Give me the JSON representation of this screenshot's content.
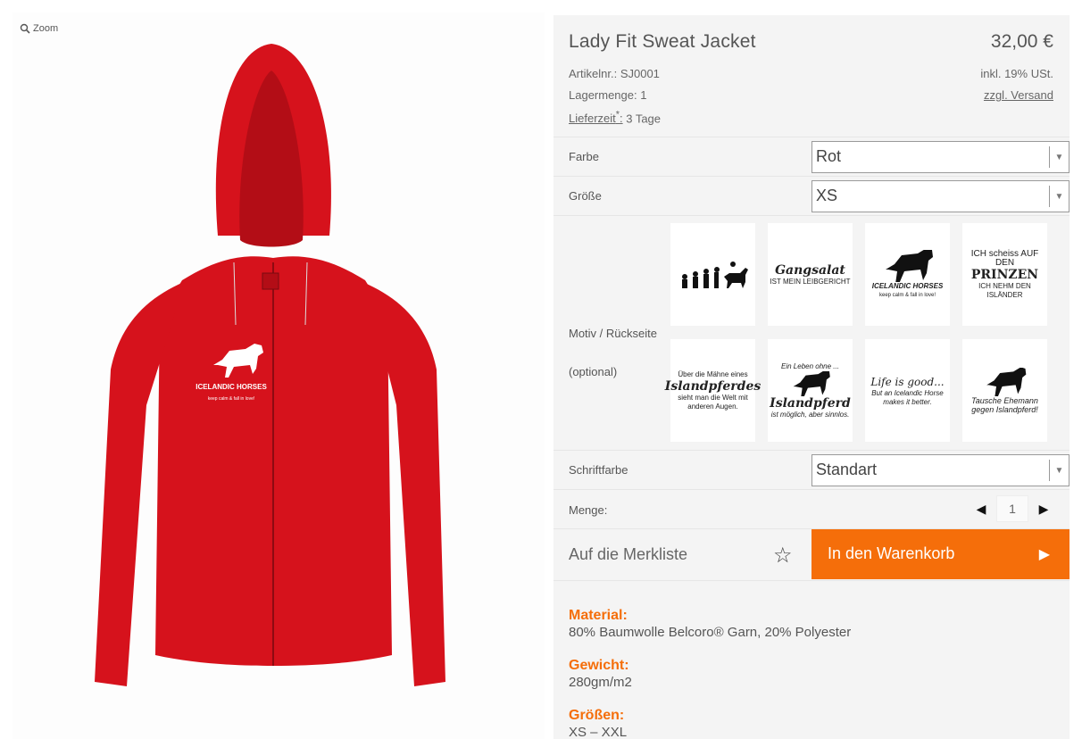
{
  "zoom_label": "Zoom",
  "product": {
    "title": "Lady Fit Sweat Jacket",
    "price": "32,00 €",
    "article_label": "Artikelnr.:",
    "article_no": "SJ0001",
    "stock_label": "Lagermenge:",
    "stock_value": "1",
    "delivery_label": "Lieferzeit",
    "delivery_sup": "*",
    "delivery_colon": ":",
    "delivery_value": "3 Tage",
    "tax_note": "inkl. 19% USt.",
    "shipping_link": "zzgl. Versand",
    "chest_print_title": "ICELANDIC HORSES",
    "chest_print_sub": "keep calm & fall in love!"
  },
  "options": {
    "farbe_label": "Farbe",
    "farbe_value": "Rot",
    "groesse_label": "Größe",
    "groesse_value": "XS",
    "motiv_label": "Motiv / Rückseite",
    "motiv_optional": "(optional)",
    "schrift_label": "Schriftfarbe",
    "schrift_value": "Standart",
    "menge_label": "Menge:",
    "menge_value": "1"
  },
  "motifs": [
    {
      "line1": "",
      "big": "",
      "line2": ""
    },
    {
      "line1": "",
      "big": "Gangsalat",
      "line2": "IST MEIN LEIBGERICHT"
    },
    {
      "line1": "",
      "big": "ICELANDIC HORSES",
      "line2": "keep calm & fall in love!"
    },
    {
      "line1": "ICH scheiss AUF DEN",
      "big": "PRINZEN",
      "line2": "ICH NEHM DEN ISLÄNDER"
    },
    {
      "line1": "Über die Mähne eines",
      "big": "Islandpferdes",
      "line2": "sieht man die Welt mit anderen Augen."
    },
    {
      "line1": "Ein Leben ohne ...",
      "big": "Islandpferd",
      "line2": "ist möglich, aber sinnlos."
    },
    {
      "line1": "Life is good...",
      "big": "",
      "line2": "But an Icelandic Horse makes it better."
    },
    {
      "line1": "",
      "big": "",
      "line2": "Tausche Ehemann gegen Islandpferd!"
    }
  ],
  "actions": {
    "wishlist_label": "Auf die Merkliste",
    "cart_label": "In den Warenkorb"
  },
  "details": [
    {
      "label": "Material:",
      "value": "80% Baumwolle Belcoro® Garn, 20% Polyester"
    },
    {
      "label": "Gewicht:",
      "value": "280gm/m2"
    },
    {
      "label": "Größen:",
      "value": "XS – XXL"
    }
  ],
  "colors": {
    "accent": "#f56e0a",
    "jacket": "#d6121c"
  }
}
